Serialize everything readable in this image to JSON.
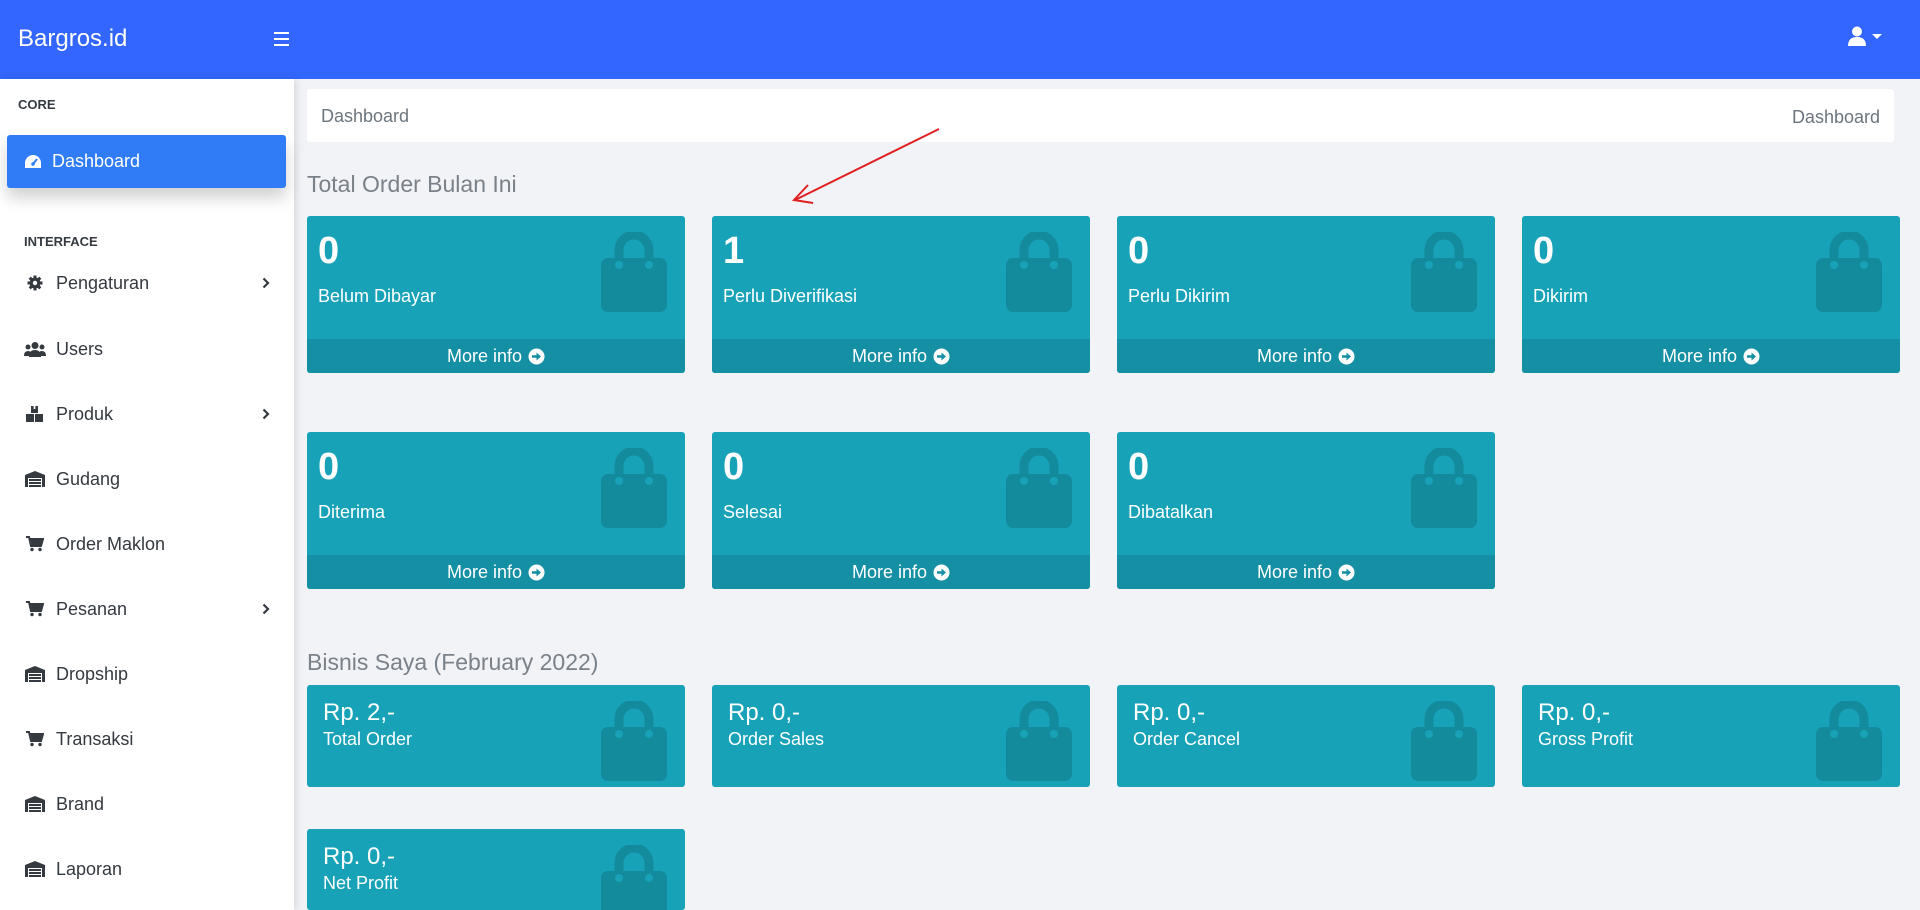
{
  "header": {
    "brand": "Bargros.id"
  },
  "sidebar": {
    "core_heading": "CORE",
    "interface_heading": "INTERFACE",
    "active_item": "Dashboard",
    "items": [
      {
        "label": "Pengaturan",
        "icon": "gear-icon",
        "chevron": true
      },
      {
        "label": "Users",
        "icon": "users-icon",
        "chevron": false
      },
      {
        "label": "Produk",
        "icon": "boxes-icon",
        "chevron": true
      },
      {
        "label": "Gudang",
        "icon": "warehouse-icon",
        "chevron": false
      },
      {
        "label": "Order Maklon",
        "icon": "cart-icon",
        "chevron": false
      },
      {
        "label": "Pesanan",
        "icon": "cart-icon",
        "chevron": true
      },
      {
        "label": "Dropship",
        "icon": "warehouse-icon",
        "chevron": false
      },
      {
        "label": "Transaksi",
        "icon": "cart-icon",
        "chevron": false
      },
      {
        "label": "Brand",
        "icon": "warehouse-icon",
        "chevron": false
      },
      {
        "label": "Laporan",
        "icon": "warehouse-icon",
        "chevron": false
      }
    ]
  },
  "breadcrumb": {
    "left": "Dashboard",
    "right": "Dashboard"
  },
  "orders": {
    "title": "Total Order Bulan Ini",
    "more_info": "More info",
    "cards": [
      {
        "value": "0",
        "label": "Belum Dibayar"
      },
      {
        "value": "1",
        "label": "Perlu Diverifikasi"
      },
      {
        "value": "0",
        "label": "Perlu Dikirim"
      },
      {
        "value": "0",
        "label": "Dikirim"
      },
      {
        "value": "0",
        "label": "Diterima"
      },
      {
        "value": "0",
        "label": "Selesai"
      },
      {
        "value": "0",
        "label": "Dibatalkan"
      }
    ]
  },
  "business": {
    "title": "Bisnis Saya (February 2022)",
    "cards": [
      {
        "value": "Rp. 2,-",
        "label": "Total Order"
      },
      {
        "value": "Rp. 0,-",
        "label": "Order Sales"
      },
      {
        "value": "Rp. 0,-",
        "label": "Order Cancel"
      },
      {
        "value": "Rp. 0,-",
        "label": "Gross Profit"
      },
      {
        "value": "Rp. 0,-",
        "label": "Net Profit"
      }
    ]
  },
  "colors": {
    "topbar": "#3366ff",
    "active": "#2f7cf6",
    "card": "#17a2b8",
    "card_footer": "#158fa3",
    "annotation_arrow": "#e02020"
  }
}
